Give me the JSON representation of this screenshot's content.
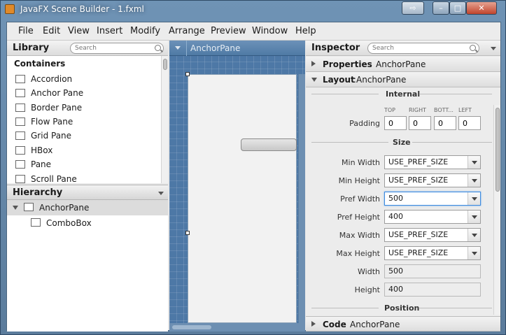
{
  "window": {
    "title": "JavaFX Scene Builder - 1.fxml",
    "min": "–",
    "max": "□",
    "close": "✕",
    "extra": "⇨"
  },
  "menu": [
    "File",
    "Edit",
    "View",
    "Insert",
    "Modify",
    "Arrange",
    "Preview",
    "Window",
    "Help"
  ],
  "library": {
    "title": "Library",
    "search_placeholder": "Search",
    "category": "Containers",
    "items": [
      "Accordion",
      "Anchor Pane",
      "Border Pane",
      "Flow Pane",
      "Grid Pane",
      "HBox",
      "Pane",
      "Scroll Pane"
    ]
  },
  "hierarchy": {
    "title": "Hierarchy",
    "nodes": [
      {
        "label": "AnchorPane",
        "expanded": true
      },
      {
        "label": "ComboBox",
        "expanded": false
      }
    ]
  },
  "canvas": {
    "title": "AnchorPane"
  },
  "inspector": {
    "title": "Inspector",
    "search_placeholder": "Search",
    "properties": {
      "label": "Properties",
      "sep": " : ",
      "target": "AnchorPane"
    },
    "layout": {
      "label": "Layout",
      "sep": " : ",
      "target": "AnchorPane"
    },
    "code": {
      "label": "Code",
      "sep": " : ",
      "target": "AnchorPane"
    },
    "internal": {
      "heading": "Internal",
      "padding_label": "Padding",
      "cols": [
        "TOP",
        "RIGHT",
        "BOTT...",
        "LEFT"
      ],
      "values": [
        "0",
        "0",
        "0",
        "0"
      ]
    },
    "size": {
      "heading": "Size",
      "min_width": {
        "label": "Min Width",
        "value": "USE_PREF_SIZE"
      },
      "min_height": {
        "label": "Min Height",
        "value": "USE_PREF_SIZE"
      },
      "pref_width": {
        "label": "Pref Width",
        "value": "500"
      },
      "pref_height": {
        "label": "Pref Height",
        "value": "400"
      },
      "max_width": {
        "label": "Max Width",
        "value": "USE_PREF_SIZE"
      },
      "max_height": {
        "label": "Max Height",
        "value": "USE_PREF_SIZE"
      },
      "width": {
        "label": "Width",
        "value": "500"
      },
      "height": {
        "label": "Height",
        "value": "400"
      }
    },
    "position_heading": "Position"
  }
}
